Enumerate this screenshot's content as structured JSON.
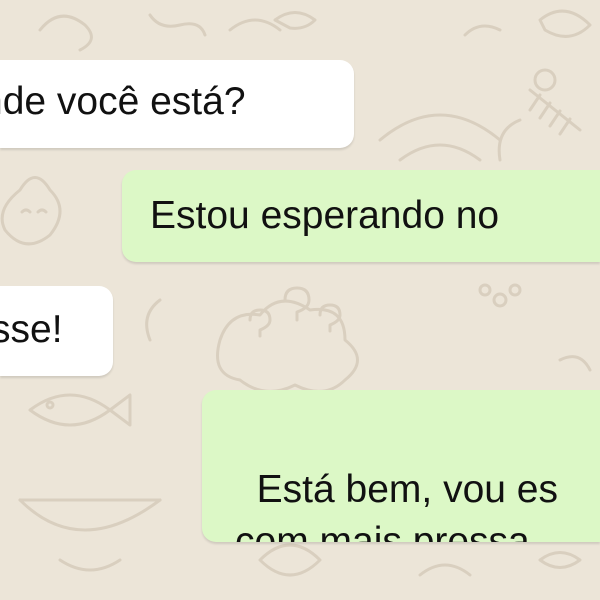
{
  "chat": {
    "background_color": "#ece5d8",
    "incoming_bubble_color": "#ffffff",
    "outgoing_bubble_color": "#dcf8c6",
    "messages": [
      {
        "direction": "incoming",
        "text": "nde você está?"
      },
      {
        "direction": "outgoing",
        "text": "Estou esperando no"
      },
      {
        "direction": "incoming",
        "text": "sse!"
      },
      {
        "direction": "outgoing",
        "text": "Está bem, vou es\ncom mais pressa"
      }
    ]
  }
}
